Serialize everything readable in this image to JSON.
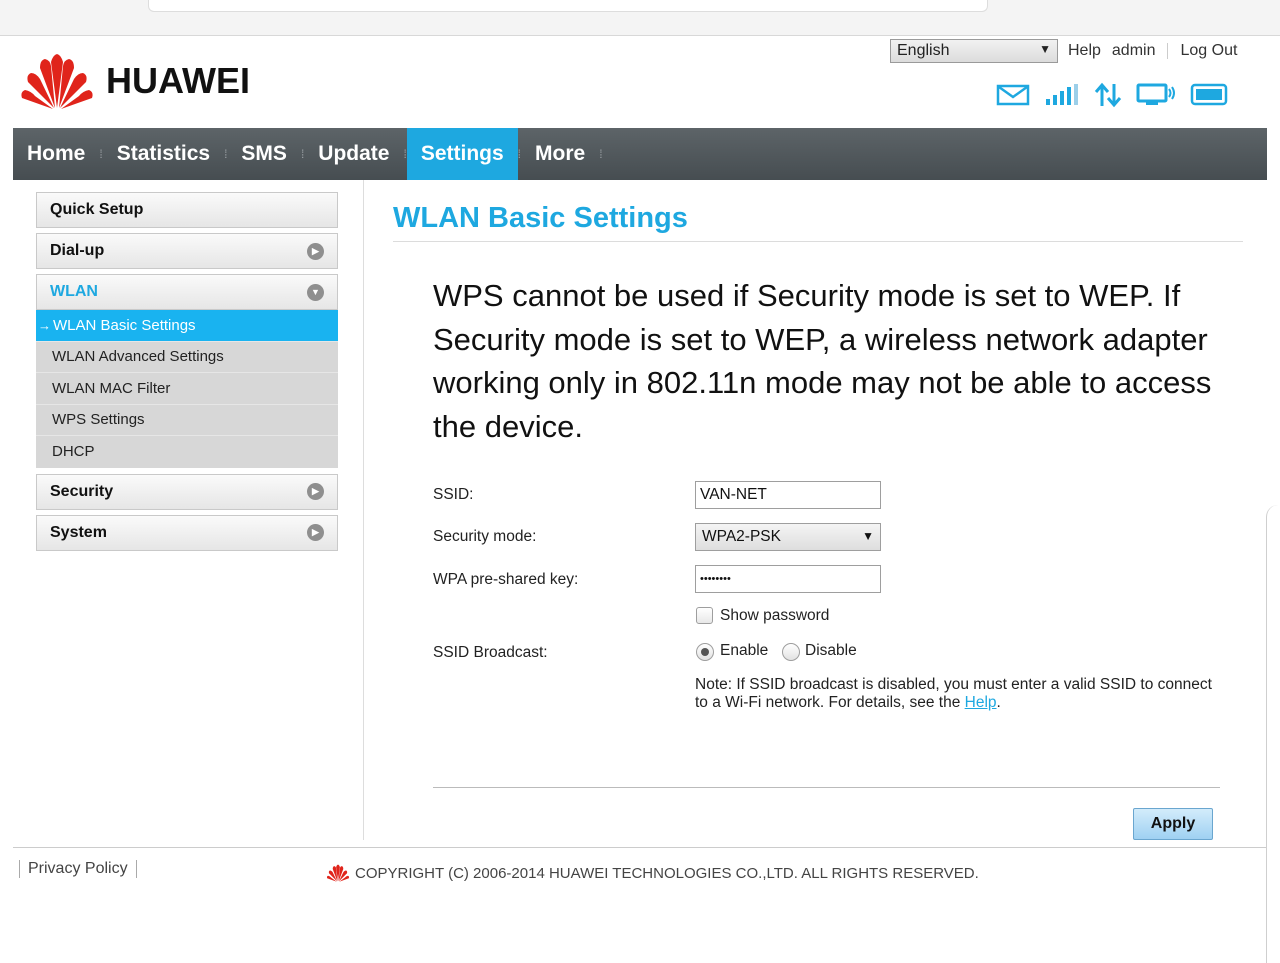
{
  "header": {
    "brand": "HUAWEI",
    "language": "English",
    "links": {
      "help": "Help",
      "user": "admin",
      "logout": "Log Out"
    }
  },
  "nav": {
    "items": [
      {
        "label": "Home"
      },
      {
        "label": "Statistics"
      },
      {
        "label": "SMS"
      },
      {
        "label": "Update"
      },
      {
        "label": "Settings"
      },
      {
        "label": "More"
      }
    ],
    "active": "Settings"
  },
  "sidebar": {
    "quick_setup": "Quick Setup",
    "dialup": "Dial-up",
    "wlan": "WLAN",
    "wlan_items": [
      "WLAN Basic Settings",
      "WLAN Advanced Settings",
      "WLAN MAC Filter",
      "WPS Settings",
      "DHCP"
    ],
    "security": "Security",
    "system": "System"
  },
  "main": {
    "title": "WLAN Basic Settings",
    "warning": "WPS cannot be used if Security mode is set to WEP. If Security mode is set to WEP, a wireless network adapter working only in 802.11n mode may not be able to access the device.",
    "ssid_label": "SSID:",
    "ssid_value": "VAN-NET",
    "security_label": "Security mode:",
    "security_value": "WPA2-PSK",
    "key_label": "WPA pre-shared key:",
    "key_value": "••••••••",
    "show_password": "Show password",
    "broadcast_label": "SSID Broadcast:",
    "enable": "Enable",
    "disable": "Disable",
    "note_text": "Note: If SSID broadcast is disabled, you must enter a valid SSID to connect to a Wi-Fi network. For details, see the ",
    "note_link": "Help",
    "note_end": ".",
    "apply": "Apply"
  },
  "footer": {
    "privacy": "Privacy Policy",
    "copyright": "COPYRIGHT (C) 2006-2014 HUAWEI TECHNOLOGIES CO.,LTD. ALL RIGHTS RESERVED."
  },
  "colors": {
    "accent": "#1ea8e0",
    "nav": "#4f565a",
    "brand_red": "#e0241b"
  }
}
